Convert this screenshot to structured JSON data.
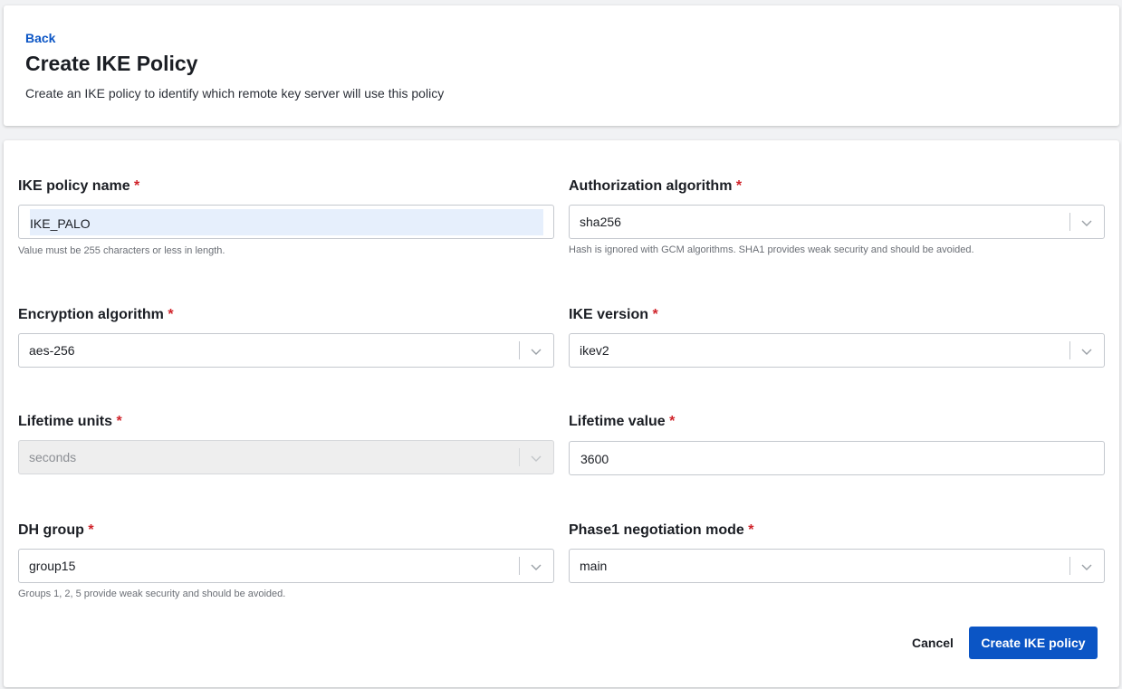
{
  "header": {
    "back_label": "Back",
    "title": "Create IKE Policy",
    "description": "Create an IKE policy to identify which remote key server will use this policy"
  },
  "form": {
    "required_marker": "*",
    "ike_policy_name": {
      "label": "IKE policy name",
      "value": "IKE_PALO",
      "helper": "Value must be 255 characters or less in length."
    },
    "authorization_algorithm": {
      "label": "Authorization algorithm",
      "value": "sha256",
      "helper": "Hash is ignored with GCM algorithms. SHA1 provides weak security and should be avoided."
    },
    "encryption_algorithm": {
      "label": "Encryption algorithm",
      "value": "aes-256"
    },
    "ike_version": {
      "label": "IKE version",
      "value": "ikev2"
    },
    "lifetime_units": {
      "label": "Lifetime units",
      "value": "seconds",
      "disabled": true
    },
    "lifetime_value": {
      "label": "Lifetime value",
      "value": "3600"
    },
    "dh_group": {
      "label": "DH group",
      "value": "group15",
      "helper": "Groups 1, 2, 5 provide weak security and should be avoided."
    },
    "phase1_negotiation_mode": {
      "label": "Phase1 negotiation mode",
      "value": "main"
    }
  },
  "actions": {
    "cancel_label": "Cancel",
    "create_label": "Create IKE policy"
  },
  "colors": {
    "primary": "#0b55c5",
    "required": "#d0242b",
    "input_highlight": "#e6effc"
  },
  "icons": {
    "select_indicator": "chevron-down-icon"
  }
}
